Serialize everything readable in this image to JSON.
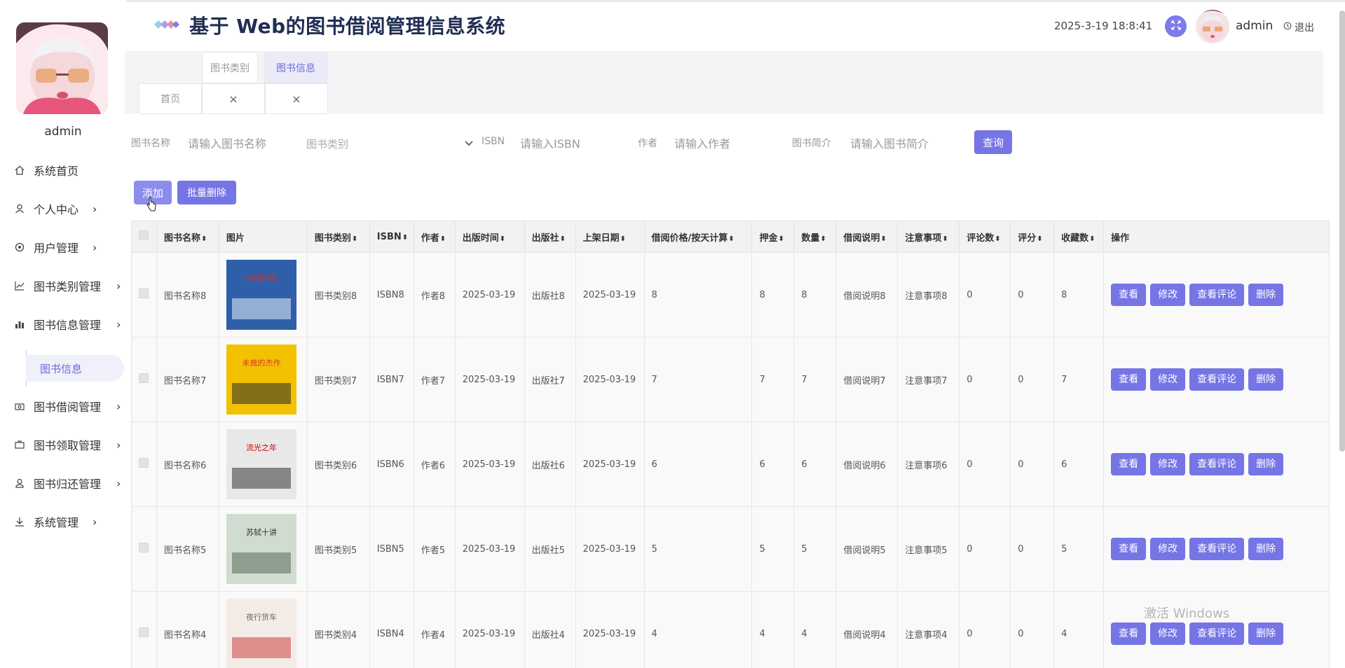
{
  "header": {
    "title": "基于 Web的图书借阅管理信息系统",
    "datetime": "2025-3-19 18:8:41",
    "username": "admin",
    "logout_label": "退出"
  },
  "sidebar": {
    "username": "admin",
    "items": [
      {
        "label": "系统首页",
        "icon": "home-icon",
        "has_arrow": false
      },
      {
        "label": "个人中心",
        "icon": "user-icon",
        "has_arrow": true
      },
      {
        "label": "用户管理",
        "icon": "target-icon",
        "has_arrow": true
      },
      {
        "label": "图书类别管理",
        "icon": "line-chart-icon",
        "has_arrow": true
      },
      {
        "label": "图书信息管理",
        "icon": "bar-chart-icon",
        "has_arrow": true
      },
      {
        "label": "图书借阅管理",
        "icon": "camera-icon",
        "has_arrow": true
      },
      {
        "label": "图书领取管理",
        "icon": "briefcase-icon",
        "has_arrow": true
      },
      {
        "label": "图书归还管理",
        "icon": "user-outline-icon",
        "has_arrow": true
      },
      {
        "label": "系统管理",
        "icon": "download-icon",
        "has_arrow": true
      }
    ],
    "active_submenu": "图书信息"
  },
  "tabs": {
    "home": "首页",
    "category": "图书类别",
    "info": "图书信息"
  },
  "search": {
    "name_label": "图书名称",
    "name_placeholder": "请输入图书名称",
    "category_label": "图书类别",
    "isbn_label": "ISBN",
    "isbn_placeholder": "请输入ISBN",
    "author_label": "作者",
    "author_placeholder": "请输入作者",
    "intro_label": "图书简介",
    "intro_placeholder": "请输入图书简介",
    "query_button": "查询"
  },
  "actions": {
    "add": "添加",
    "batch_delete": "批量删除"
  },
  "table": {
    "headers": [
      "图书名称",
      "图片",
      "图书类别",
      "ISBN",
      "作者",
      "出版时间",
      "出版社",
      "上架日期",
      "借阅价格/按天计算",
      "押金",
      "数量",
      "借阅说明",
      "注意事项",
      "评论数",
      "评分",
      "收藏数",
      "操作"
    ],
    "op_buttons": [
      "查看",
      "修改",
      "查看评论",
      "删除"
    ],
    "rows": [
      {
        "name": "图书名称8",
        "category": "图书类别8",
        "isbn": "ISBN8",
        "author": "作者8",
        "pub_date": "2025-03-19",
        "publisher": "出版社8",
        "shelf_date": "2025-03-19",
        "price": "8",
        "deposit": "8",
        "qty": "8",
        "borrow_note": "借阅说明8",
        "notice": "注意事项8",
        "comments": "0",
        "rating": "0",
        "favorites": "8",
        "cover_title": "树理历程"
      },
      {
        "name": "图书名称7",
        "category": "图书类别7",
        "isbn": "ISBN7",
        "author": "作者7",
        "pub_date": "2025-03-19",
        "publisher": "出版社7",
        "shelf_date": "2025-03-19",
        "price": "7",
        "deposit": "7",
        "qty": "7",
        "borrow_note": "借阅说明7",
        "notice": "注意事项7",
        "comments": "0",
        "rating": "0",
        "favorites": "7",
        "cover_title": "未竟的杰作"
      },
      {
        "name": "图书名称6",
        "category": "图书类别6",
        "isbn": "ISBN6",
        "author": "作者6",
        "pub_date": "2025-03-19",
        "publisher": "出版社6",
        "shelf_date": "2025-03-19",
        "price": "6",
        "deposit": "6",
        "qty": "6",
        "borrow_note": "借阅说明6",
        "notice": "注意事项6",
        "comments": "0",
        "rating": "0",
        "favorites": "6",
        "cover_title": "流光之年"
      },
      {
        "name": "图书名称5",
        "category": "图书类别5",
        "isbn": "ISBN5",
        "author": "作者5",
        "pub_date": "2025-03-19",
        "publisher": "出版社5",
        "shelf_date": "2025-03-19",
        "price": "5",
        "deposit": "5",
        "qty": "5",
        "borrow_note": "借阅说明5",
        "notice": "注意事项5",
        "comments": "0",
        "rating": "0",
        "favorites": "5",
        "cover_title": "苏轼十讲"
      },
      {
        "name": "图书名称4",
        "category": "图书类别4",
        "isbn": "ISBN4",
        "author": "作者4",
        "pub_date": "2025-03-19",
        "publisher": "出版社4",
        "shelf_date": "2025-03-19",
        "price": "4",
        "deposit": "4",
        "qty": "4",
        "borrow_note": "借阅说明4",
        "notice": "注意事项4",
        "comments": "0",
        "rating": "0",
        "favorites": "4",
        "cover_title": "夜行货车"
      }
    ]
  },
  "watermark": "激活 Windows",
  "colors": {
    "accent": "#7575e6",
    "title": "#1f2d52",
    "active_submenu_bg": "#f0f0fb"
  }
}
